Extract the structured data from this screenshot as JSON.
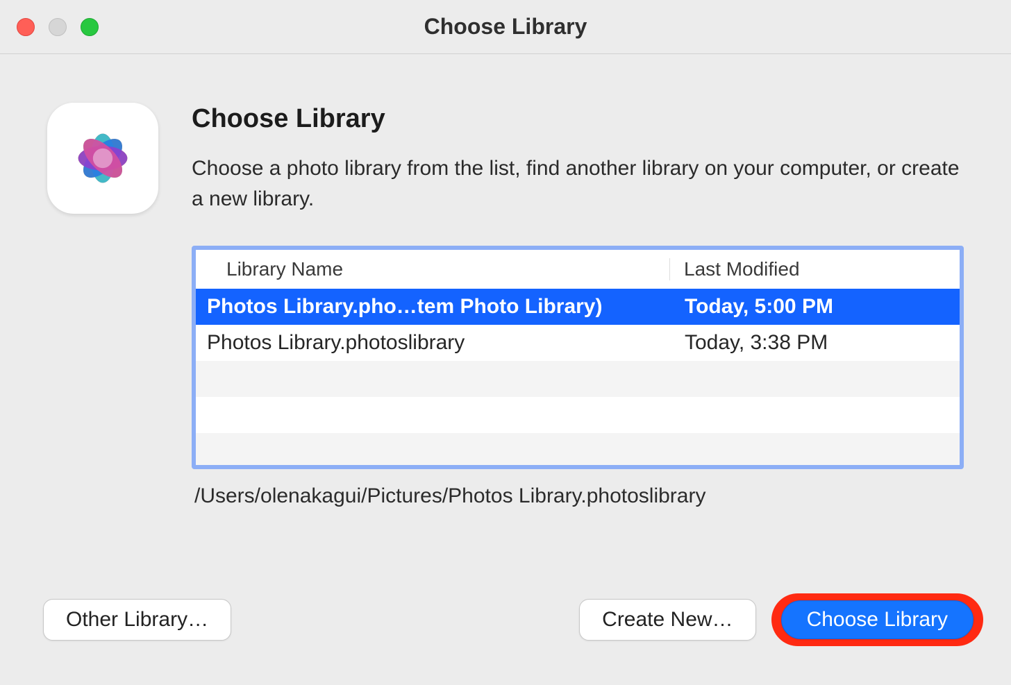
{
  "window": {
    "title": "Choose Library"
  },
  "header": {
    "heading": "Choose Library",
    "description": "Choose a photo library from the list, find another library on your computer, or create a new library."
  },
  "table": {
    "columns": {
      "name": "Library Name",
      "modified": "Last Modified"
    },
    "rows": [
      {
        "name": "Photos Library.pho…tem Photo Library)",
        "modified": "Today, 5:00 PM",
        "selected": true
      },
      {
        "name": "Photos Library.photoslibrary",
        "modified": "Today, 3:38 PM",
        "selected": false
      }
    ]
  },
  "path": "/Users/olenakagui/Pictures/Photos Library.photoslibrary",
  "buttons": {
    "other": "Other Library…",
    "create": "Create New…",
    "choose": "Choose Library"
  },
  "icon_name": "photos-app-icon",
  "colors": {
    "selection": "#1463ff",
    "focus_ring": "#8caef6",
    "highlight_annotation": "#ff2a12",
    "primary_button": "#1574ff"
  }
}
